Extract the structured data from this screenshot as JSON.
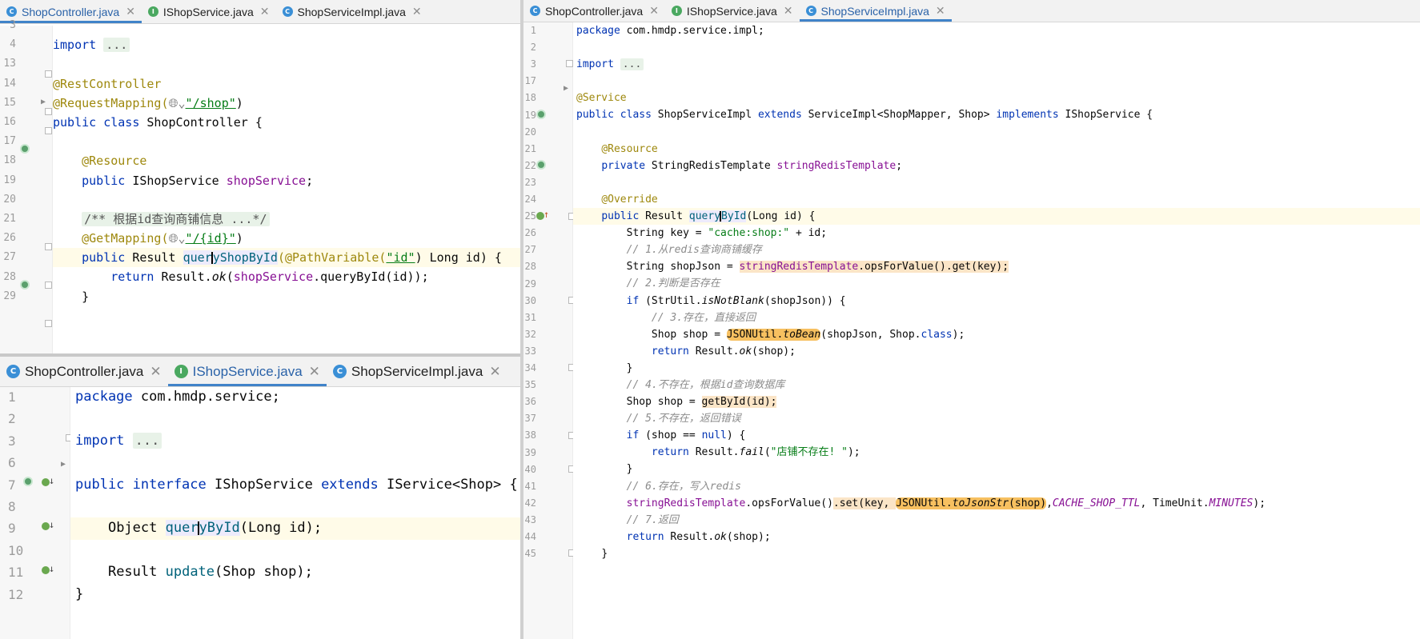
{
  "top_left": {
    "tabs": [
      {
        "label": "ShopController.java",
        "type": "C",
        "active": true
      },
      {
        "label": "IShopService.java",
        "type": "I",
        "active": false
      },
      {
        "label": "ShopServiceImpl.java",
        "type": "C",
        "active": false
      }
    ],
    "line_numbers": [
      "3",
      "4",
      "13",
      "14",
      "15",
      "16",
      "17",
      "18",
      "19",
      "20",
      "21",
      "26",
      "27",
      "28",
      "29"
    ],
    "code": {
      "l4_import": "import",
      "l4_fold": "...",
      "l14": "@RestController",
      "l15_ann": "@RequestMapping(",
      "l15_str": "\"/shop\"",
      "l15_end": ")",
      "l16_kw": "public class",
      "l16_rest": " ShopController {",
      "l18": "@Resource",
      "l19_kw": "public",
      "l19_type": " IShopService ",
      "l19_field": "shopService",
      "l19_end": ";",
      "l21": "/** 根据id查询商铺信息 ...*/",
      "l26_ann": "@GetMapping(",
      "l26_str": "\"/{id}\"",
      "l26_end": ")",
      "l27_kw": "public",
      "l27_type": " Result ",
      "l27_m1": "quer",
      "l27_m2": "yShopById",
      "l27_ann": "(@PathVariable(",
      "l27_str": "\"id\"",
      "l27_rest": ") Long id) {",
      "l28_kw": "return",
      "l28_a": " Result.",
      "l28_ok": "ok",
      "l28_b": "(",
      "l28_field": "shopService",
      "l28_c": ".queryById(id));",
      "l29": "}"
    }
  },
  "bottom_left": {
    "tabs": [
      {
        "label": "ShopController.java",
        "type": "C",
        "active": false
      },
      {
        "label": "IShopService.java",
        "type": "I",
        "active": true
      },
      {
        "label": "ShopServiceImpl.java",
        "type": "C",
        "active": false
      }
    ],
    "line_numbers": [
      "1",
      "2",
      "3",
      "6",
      "7",
      "8",
      "9",
      "10",
      "11",
      "12"
    ],
    "code": {
      "l1_kw": "package",
      "l1_rest": " com.hmdp.service;",
      "l3_kw": "import",
      "l3_fold": "...",
      "l7_kw1": "public interface",
      "l7_mid": " IShopService ",
      "l7_kw2": "extends",
      "l7_rest": " IService<Shop> {",
      "l9_a": "Object ",
      "l9_m1": "quer",
      "l9_m2": "yById",
      "l9_rest": "(Long id);",
      "l11_a": "Result ",
      "l11_m": "update",
      "l11_rest": "(Shop shop);",
      "l12": "}"
    }
  },
  "right": {
    "tabs": [
      {
        "label": "ShopController.java",
        "type": "C",
        "active": false
      },
      {
        "label": "IShopService.java",
        "type": "I",
        "active": false
      },
      {
        "label": "ShopServiceImpl.java",
        "type": "C",
        "active": true
      }
    ],
    "line_numbers": [
      "1",
      "2",
      "3",
      "17",
      "18",
      "19",
      "20",
      "21",
      "22",
      "23",
      "24",
      "25",
      "26",
      "27",
      "28",
      "29",
      "30",
      "31",
      "32",
      "33",
      "34",
      "35",
      "36",
      "37",
      "38",
      "39",
      "40",
      "41",
      "42",
      "43",
      "44",
      "45"
    ],
    "code": {
      "l1_kw": "package",
      "l1_rest": " com.hmdp.service.impl;",
      "l3_kw": "import",
      "l3_fold": "...",
      "l18": "@Service",
      "l19_kw1": "public class",
      "l19_a": " ShopServiceImpl ",
      "l19_kw2": "extends",
      "l19_b": " ServiceImpl<ShopMapper, Shop> ",
      "l19_kw3": "implements",
      "l19_c": " IShopService {",
      "l21": "@Resource",
      "l22_kw": "private",
      "l22_a": " StringRedisTemplate ",
      "l22_field": "stringRedisTemplate",
      "l22_end": ";",
      "l24": "@Override",
      "l25_kw": "public",
      "l25_a": " Result ",
      "l25_m1": "query",
      "l25_m2": "ById",
      "l25_rest": "(Long id) {",
      "l26_a": "String key = ",
      "l26_str": "\"cache:shop:\"",
      "l26_b": " + id;",
      "l27": "// 1.从redis查询商铺缓存",
      "l28_a": "String shopJson = ",
      "l28_field": "stringRedisTemplate",
      "l28_b": ".opsForValue()",
      "l28_c": ".get(key);",
      "l29": "// 2.判断是否存在",
      "l30_kw": "if",
      "l30_a": " (StrUtil.",
      "l30_it": "isNotBlank",
      "l30_b": "(shopJson)) {",
      "l31": "// 3.存在，直接返回",
      "l32_a": "Shop shop = ",
      "l32_h1": "JSONUtil.",
      "l32_h2": "toBean",
      "l32_b": "(shopJson, Shop.",
      "l32_kw": "class",
      "l32_c": ");",
      "l33_kw": "return",
      "l33_a": " Result.",
      "l33_it": "ok",
      "l33_b": "(shop);",
      "l34": "}",
      "l35": "// 4.不存在，根据id查询数据库",
      "l36_a": "Shop shop = ",
      "l36_h": "getById(id);",
      "l37": "// 5.不存在，返回错误",
      "l38_kw": "if",
      "l38_a": " (shop == ",
      "l38_kw2": "null",
      "l38_b": ") {",
      "l39_kw": "return",
      "l39_a": " Result.",
      "l39_it": "fail",
      "l39_b": "(",
      "l39_str": "\"店铺不存在! \"",
      "l39_c": ");",
      "l40": "}",
      "l41": "// 6.存在，写入redis",
      "l42_field": "stringRedisTemplate",
      "l42_a": ".opsForValue()",
      "l42_b": ".set(key, ",
      "l42_h1": "JSONUtil.",
      "l42_h2": "toJsonStr",
      "l42_h3": "(shop)",
      "l42_c": ",",
      "l42_const": "CACHE_SHOP_TTL",
      "l42_d": ", TimeUnit.",
      "l42_const2": "MINUTES",
      "l42_e": ");",
      "l43": "// 7.返回",
      "l44_kw": "return",
      "l44_a": " Result.",
      "l44_it": "ok",
      "l44_b": "(shop);",
      "l45": "}"
    }
  },
  "colors": {
    "keyword": "#0033b3",
    "annotation": "#9e880d",
    "string": "#067d17",
    "field": "#871094",
    "comment": "#8c8c8c",
    "tab_active_underline": "#4083c9",
    "warning_highlight": "#f7c060"
  },
  "icons": {
    "class_file": "class-c-icon",
    "interface_file": "interface-i-icon",
    "close": "close-icon",
    "bean": "spring-bean-icon",
    "implemented": "implemented-icon"
  }
}
